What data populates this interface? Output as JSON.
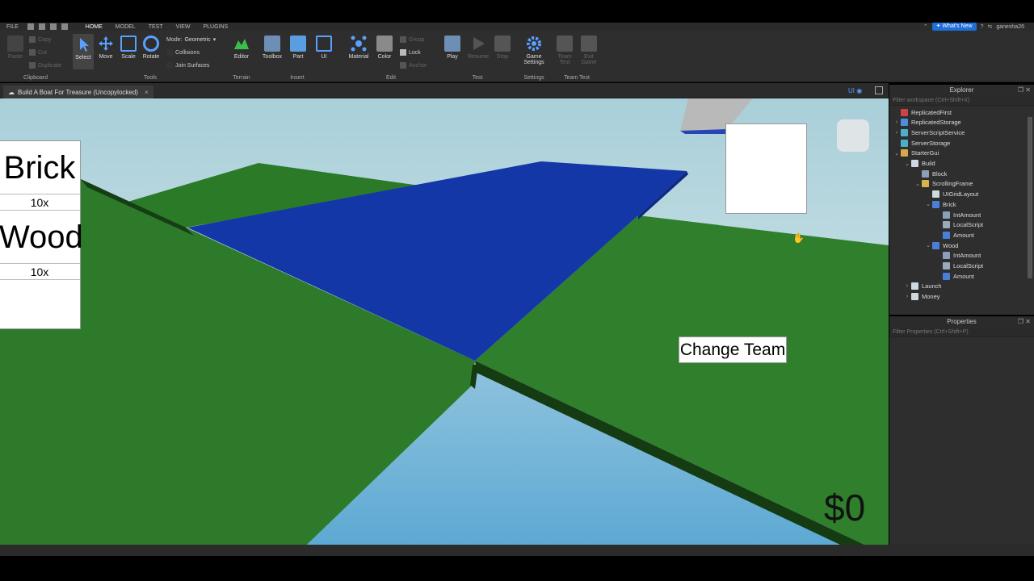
{
  "menu": {
    "items": [
      "FILE",
      "HOME",
      "MODEL",
      "TEST",
      "VIEW",
      "PLUGINS"
    ],
    "active": "HOME",
    "whats_new": "What's New",
    "user": "ganesha26"
  },
  "ribbon": {
    "clipboard": {
      "label": "Clipboard",
      "paste": "Paste",
      "copy": "Copy",
      "cut": "Cut",
      "duplicate": "Duplicate"
    },
    "tools": {
      "label": "Tools",
      "select": "Select",
      "move": "Move",
      "scale": "Scale",
      "rotate": "Rotate",
      "mode_label": "Mode:",
      "mode_value": "Geometric",
      "collisions": "Collisions",
      "join_surfaces": "Join Surfaces"
    },
    "terrain": {
      "label": "Terrain",
      "editor": "Editor"
    },
    "insert": {
      "label": "Insert",
      "toolbox": "Toolbox",
      "part": "Part",
      "ui": "UI"
    },
    "edit": {
      "label": "Edit",
      "material": "Material",
      "color": "Color",
      "group": "Group",
      "lock": "Lock",
      "anchor": "Anchor"
    },
    "test": {
      "label": "Test",
      "play": "Play",
      "resume": "Resume",
      "stop": "Stop"
    },
    "settings": {
      "label": "Settings",
      "game_settings_1": "Game",
      "game_settings_2": "Settings"
    },
    "team_test": {
      "label": "Team Test",
      "team_test_1": "Team",
      "team_test_2": "Test",
      "exit_game_1": "Exit",
      "exit_game_2": "Game"
    }
  },
  "doc_tab": {
    "title": "Build A Boat For Treasure (Uncopylocked)",
    "close": "×",
    "ui_toggle": "UI"
  },
  "game_gui": {
    "brick_label": "Brick",
    "brick_amount": "10x",
    "wood_label": "Wood",
    "wood_amount": "10x",
    "change_team": "Change Team",
    "money": "$0"
  },
  "explorer": {
    "title": "Explorer",
    "filter_placeholder": "Filter workspace (Ctrl+Shift+X)",
    "items": [
      {
        "label": "ReplicatedFirst",
        "depth": 0,
        "arrow": "",
        "icon": "#c44"
      },
      {
        "label": "ReplicatedStorage",
        "depth": 0,
        "arrow": "›",
        "icon": "#4a8fd9"
      },
      {
        "label": "ServerScriptService",
        "depth": 0,
        "arrow": "›",
        "icon": "#4ab0c9"
      },
      {
        "label": "ServerStorage",
        "depth": 0,
        "arrow": "",
        "icon": "#4ab0c9"
      },
      {
        "label": "StarterGui",
        "depth": 0,
        "arrow": "⌄",
        "icon": "#d9a84a"
      },
      {
        "label": "Build",
        "depth": 1,
        "arrow": "⌄",
        "icon": "#cfd8e0"
      },
      {
        "label": "Block",
        "depth": 2,
        "arrow": "",
        "icon": "#8aa0b8"
      },
      {
        "label": "ScrollingFrame",
        "depth": 2,
        "arrow": "⌄",
        "icon": "#d9b44a"
      },
      {
        "label": "UIGridLayout",
        "depth": 3,
        "arrow": "",
        "icon": "#cfd8e0"
      },
      {
        "label": "Brick",
        "depth": 3,
        "arrow": "⌄",
        "icon": "#4a7fd9"
      },
      {
        "label": "IntAmount",
        "depth": 4,
        "arrow": "",
        "icon": "#8aa0b8"
      },
      {
        "label": "LocalScript",
        "depth": 4,
        "arrow": "",
        "icon": "#9ab"
      },
      {
        "label": "Amount",
        "depth": 4,
        "arrow": "",
        "icon": "#4a7fd9"
      },
      {
        "label": "Wood",
        "depth": 3,
        "arrow": "⌄",
        "icon": "#4a7fd9"
      },
      {
        "label": "IntAmount",
        "depth": 4,
        "arrow": "",
        "icon": "#8aa0b8"
      },
      {
        "label": "LocalScript",
        "depth": 4,
        "arrow": "",
        "icon": "#9ab"
      },
      {
        "label": "Amount",
        "depth": 4,
        "arrow": "",
        "icon": "#4a7fd9"
      },
      {
        "label": "Launch",
        "depth": 1,
        "arrow": "›",
        "icon": "#cfd8e0"
      },
      {
        "label": "Money",
        "depth": 1,
        "arrow": "›",
        "icon": "#cfd8e0"
      }
    ]
  },
  "properties": {
    "title": "Properties",
    "filter_placeholder": "Filter Properties (Ctrl+Shift+P)"
  }
}
